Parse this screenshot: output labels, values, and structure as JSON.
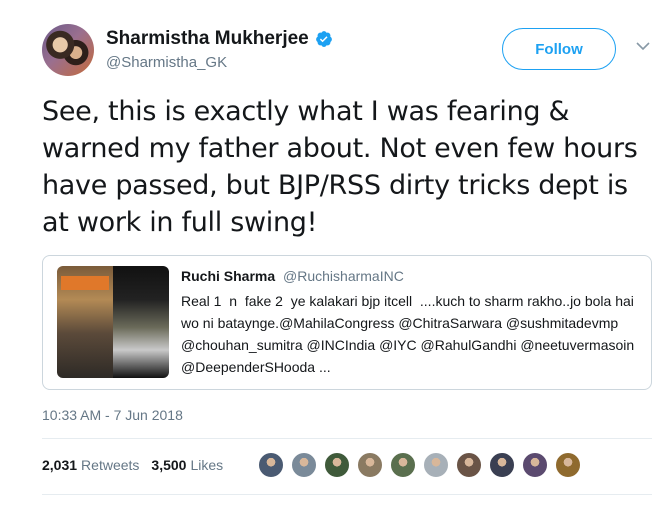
{
  "user": {
    "display_name": "Sharmistha Mukherjee",
    "handle": "@Sharmistha_GK",
    "verified": true
  },
  "actions": {
    "follow_label": "Follow",
    "menu_icon": "chevron-down-icon"
  },
  "tweet": {
    "text": "See, this is exactly what I was fearing & warned my father about. Not even few hours have passed, but BJP/RSS dirty tricks dept is at work in full swing!",
    "timestamp": "10:33 AM - 7 Jun 2018"
  },
  "quote": {
    "name": "Ruchi Sharma",
    "handle": "@RuchisharmaINC",
    "text": "Real 1  n  fake 2  ye kalakari bjp itcell  ....kuch to sharm rakho..jo bola hai wo ni bataynge.@MahilaCongress @ChitraSarwara @sushmitadevmp @chouhan_sumitra @INCIndia @IYC @RahulGandhi @neetuvermasoin @DeependerSHooda ..."
  },
  "stats": {
    "retweets_count": "2,031",
    "retweets_label": "Retweets",
    "likes_count": "3,500",
    "likes_label": "Likes"
  },
  "likers": [
    {
      "color": "#4a5a72"
    },
    {
      "color": "#7a8a99"
    },
    {
      "color": "#3f5a3a"
    },
    {
      "color": "#8a7a62"
    },
    {
      "color": "#5a6f4e"
    },
    {
      "color": "#a7b0b8"
    },
    {
      "color": "#6a5446"
    },
    {
      "color": "#3a3f52"
    },
    {
      "color": "#5b4a6f"
    },
    {
      "color": "#8f6a2e"
    }
  ],
  "colors": {
    "accent": "#1da1f2",
    "secondary_text": "#657786"
  }
}
